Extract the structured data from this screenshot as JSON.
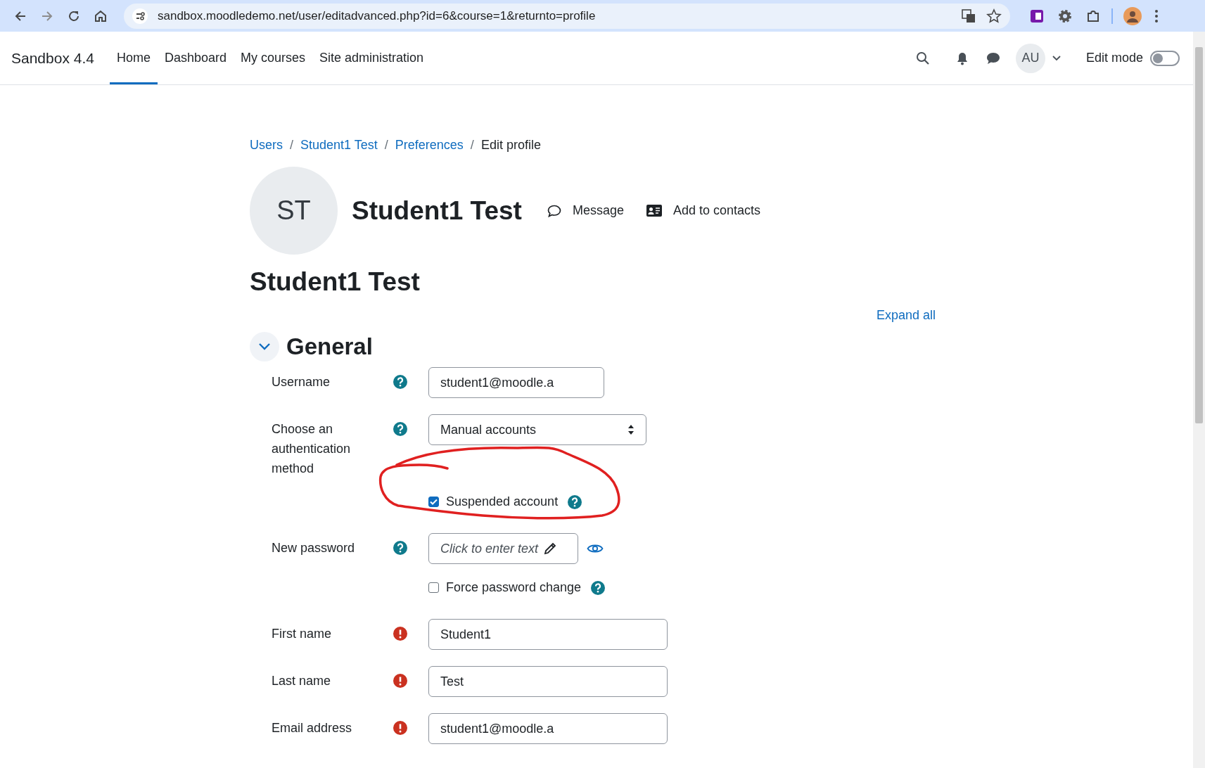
{
  "browser": {
    "url": "sandbox.moodledemo.net/user/editadvanced.php?id=6&course=1&returnto=profile"
  },
  "navbar": {
    "brand": "Sandbox 4.4",
    "items": [
      {
        "label": "Home",
        "selected": true
      },
      {
        "label": "Dashboard",
        "selected": false
      },
      {
        "label": "My courses",
        "selected": false
      },
      {
        "label": "Site administration",
        "selected": false
      }
    ],
    "avatar": "AU",
    "edit_mode": {
      "label": "Edit mode",
      "on": false
    }
  },
  "breadcrumb": [
    {
      "kind": "link",
      "label": "Users"
    },
    {
      "kind": "separator",
      "label": "/"
    },
    {
      "kind": "link",
      "label": "Student1 Test"
    },
    {
      "kind": "separator",
      "label": "/"
    },
    {
      "kind": "link",
      "label": "Preferences"
    },
    {
      "kind": "separator",
      "label": "/"
    },
    {
      "kind": "current",
      "label": "Edit profile"
    }
  ],
  "profile": {
    "initials": "ST",
    "name": "Student1 Test",
    "actions": [
      {
        "kind": "message",
        "label": "Message"
      },
      {
        "kind": "contact",
        "label": "Add to contacts"
      }
    ]
  },
  "heading": "Student1 Test",
  "expand_all": "Expand all",
  "section": {
    "title": "General",
    "expanded": true,
    "fields": [
      {
        "kind": "short-text",
        "label": "Username",
        "required": false,
        "value": "student1@moodle.a"
      },
      {
        "kind": "select",
        "label": "Choose an authentication method",
        "required": false,
        "value": "Manual accounts"
      },
      {
        "kind": "checkbox",
        "label": "Suspended account",
        "required": false,
        "checked": true,
        "annotated": true
      },
      {
        "kind": "password",
        "label": "New password",
        "required": false,
        "placeholder": "Click to enter text"
      },
      {
        "kind": "checkbox",
        "label": "Force password change",
        "required": false,
        "checked": false,
        "annotated": false
      },
      {
        "kind": "text",
        "label": "First name",
        "required": true,
        "value": "Student1"
      },
      {
        "kind": "text",
        "label": "Last name",
        "required": true,
        "value": "Test"
      },
      {
        "kind": "text",
        "label": "Email address",
        "required": true,
        "value": "student1@moodle.a"
      }
    ]
  }
}
